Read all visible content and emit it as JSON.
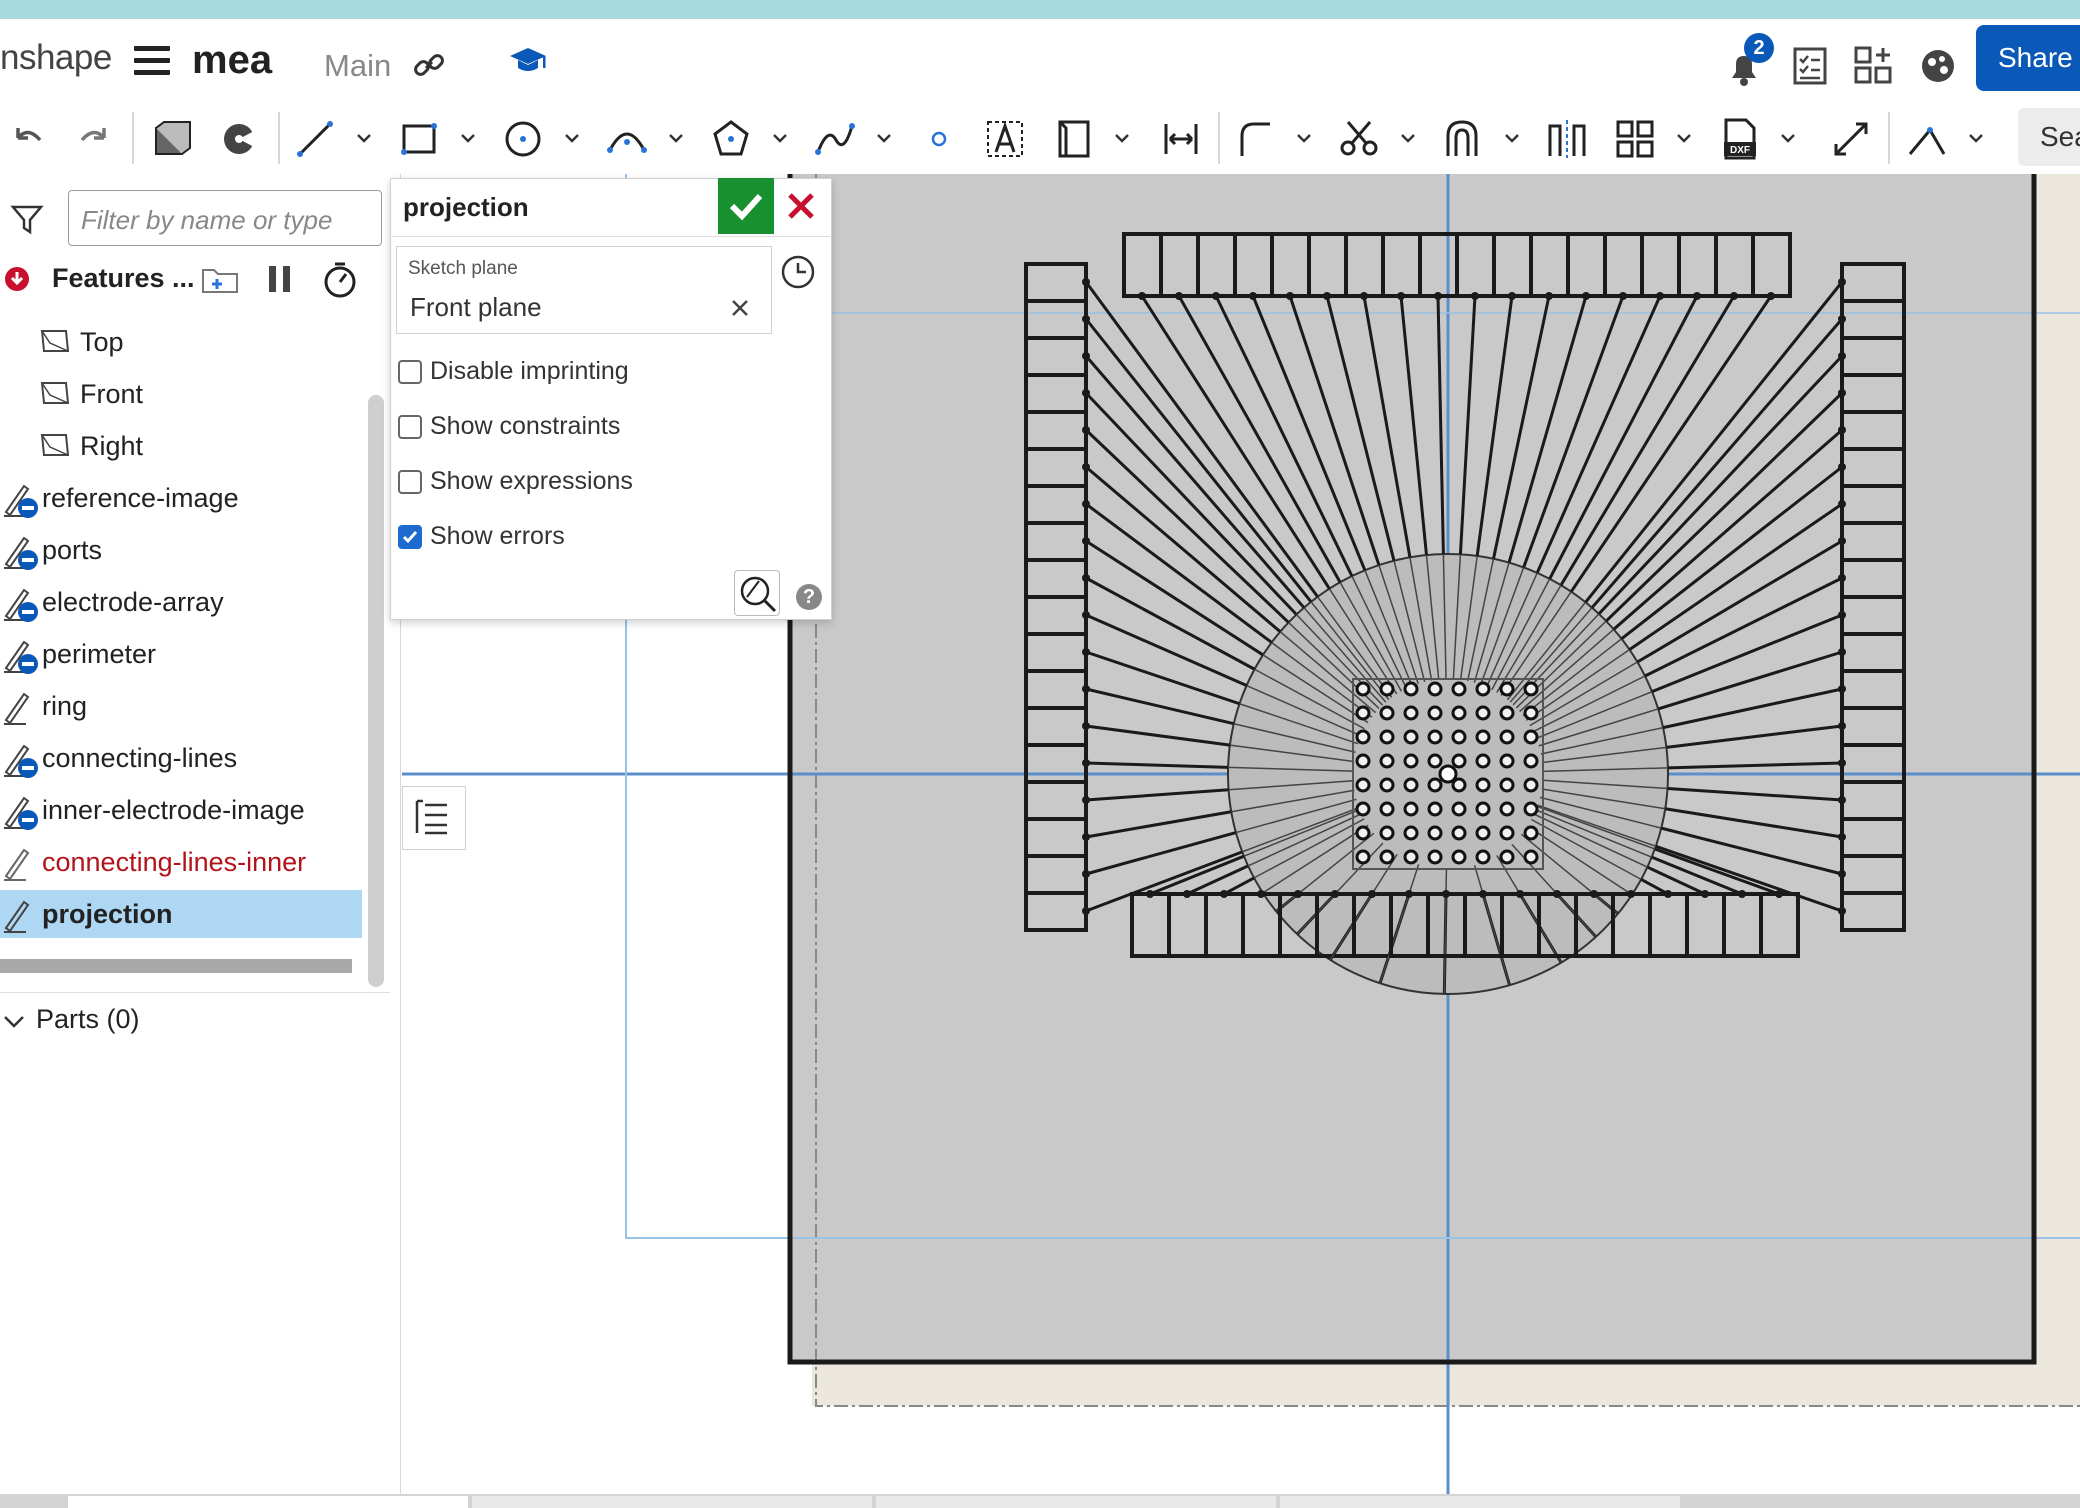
{
  "header": {
    "brand": "nshape",
    "doc_name": "mea",
    "branch": "Main",
    "notifications_count": "2",
    "share_label": "Share"
  },
  "toolbar": {
    "search_label": "Sea"
  },
  "feature_panel": {
    "filter_placeholder": "Filter by name or type",
    "title": "Features ...",
    "planes": [
      {
        "label": "Top"
      },
      {
        "label": "Front"
      },
      {
        "label": "Right"
      }
    ],
    "sketches": [
      {
        "label": "reference-image",
        "status": "suppressed"
      },
      {
        "label": "ports",
        "status": "suppressed"
      },
      {
        "label": "electrode-array",
        "status": "suppressed"
      },
      {
        "label": "perimeter",
        "status": "suppressed"
      },
      {
        "label": "ring",
        "status": "normal"
      },
      {
        "label": "connecting-lines",
        "status": "suppressed"
      },
      {
        "label": "inner-electrode-image",
        "status": "suppressed"
      },
      {
        "label": "connecting-lines-inner",
        "status": "error"
      },
      {
        "label": "projection",
        "status": "selected"
      }
    ],
    "parts_label": "Parts (0)"
  },
  "sketch_dialog": {
    "name": "projection",
    "plane_label": "Sketch plane",
    "plane_value": "Front plane",
    "options": [
      {
        "label": "Disable imprinting",
        "checked": false
      },
      {
        "label": "Show constraints",
        "checked": false
      },
      {
        "label": "Show expressions",
        "checked": false
      },
      {
        "label": "Show errors",
        "checked": true
      }
    ],
    "help_label": "?"
  },
  "colors": {
    "accent": "#0a58b8",
    "ok": "#17902f",
    "cancel": "#c8102e",
    "selection": "#aed7f4",
    "error_text": "#b3131b"
  }
}
